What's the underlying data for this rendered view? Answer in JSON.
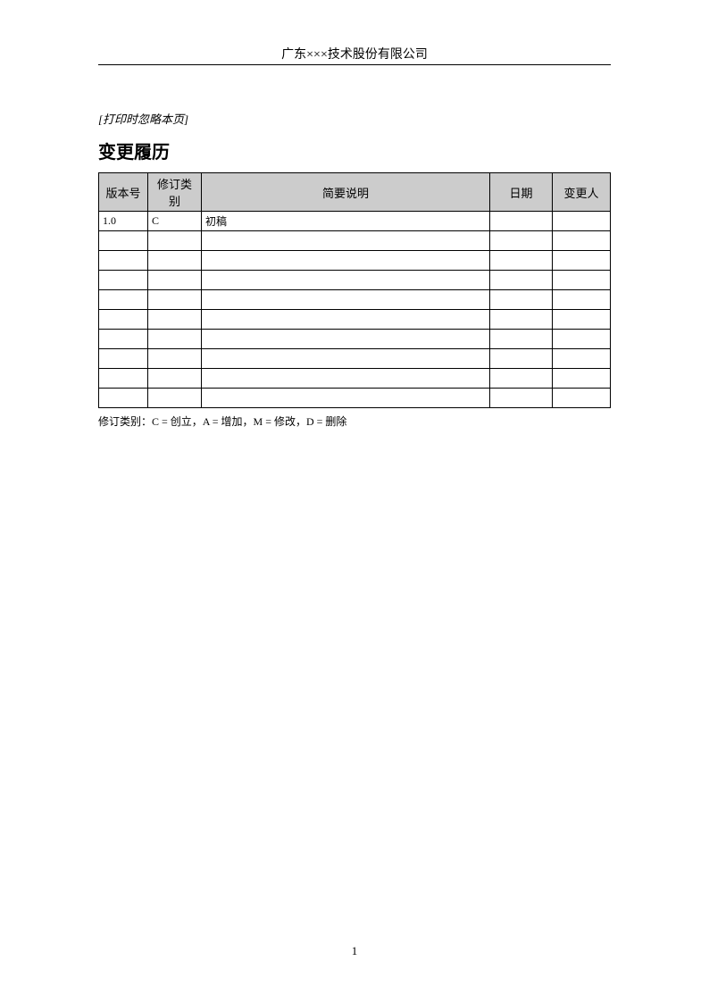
{
  "header": {
    "company": "广东×××技术股份有限公司"
  },
  "skip_note": "[打印时忽略本页]",
  "section_title": "变更履历",
  "table": {
    "headers": {
      "version": "版本号",
      "type": "修订类别",
      "desc": "简要说明",
      "date": "日期",
      "author": "变更人"
    },
    "rows": [
      {
        "version": "1.0",
        "type": "C",
        "desc": "初稿",
        "date": "",
        "author": ""
      },
      {
        "version": "",
        "type": "",
        "desc": "",
        "date": "",
        "author": ""
      },
      {
        "version": "",
        "type": "",
        "desc": "",
        "date": "",
        "author": ""
      },
      {
        "version": "",
        "type": "",
        "desc": "",
        "date": "",
        "author": ""
      },
      {
        "version": "",
        "type": "",
        "desc": "",
        "date": "",
        "author": ""
      },
      {
        "version": "",
        "type": "",
        "desc": "",
        "date": "",
        "author": ""
      },
      {
        "version": "",
        "type": "",
        "desc": "",
        "date": "",
        "author": ""
      },
      {
        "version": "",
        "type": "",
        "desc": "",
        "date": "",
        "author": ""
      },
      {
        "version": "",
        "type": "",
        "desc": "",
        "date": "",
        "author": ""
      },
      {
        "version": "",
        "type": "",
        "desc": "",
        "date": "",
        "author": ""
      }
    ]
  },
  "legend": "修订类别：C = 创立，A = 增加，M = 修改，D = 删除",
  "page_number": "1"
}
